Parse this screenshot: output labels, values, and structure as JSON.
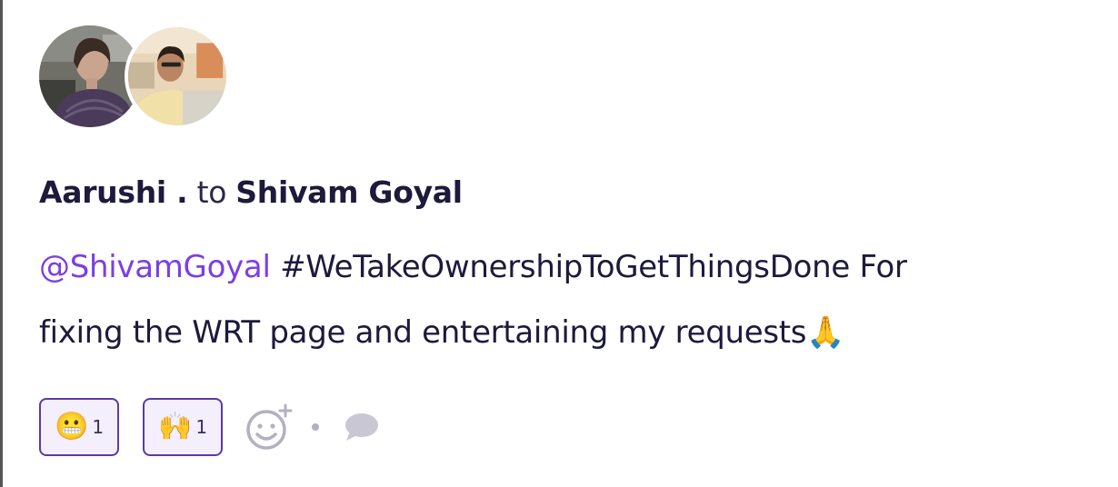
{
  "post": {
    "author": "Aarushi .",
    "connector": "to",
    "recipient": "Shivam Goyal",
    "mention": "@ShivamGoyal",
    "body_line1": " #WeTakeOwnershipToGetThingsDone For",
    "body_line2": "fixing the WRT page and entertaining my requests🙏"
  },
  "reactions": [
    {
      "emoji": "😬",
      "count": "1"
    },
    {
      "emoji": "🙌",
      "count": "1"
    }
  ],
  "icons": {
    "add_reaction": "add-reaction-icon",
    "separator": "dot-separator",
    "comment": "comment-icon"
  },
  "colors": {
    "mention": "#7b3fe4",
    "text": "#1d1a3b",
    "chip_border": "#5b3aa6",
    "chip_bg": "#f4effc",
    "icon_gray": "#b3b1bf"
  }
}
